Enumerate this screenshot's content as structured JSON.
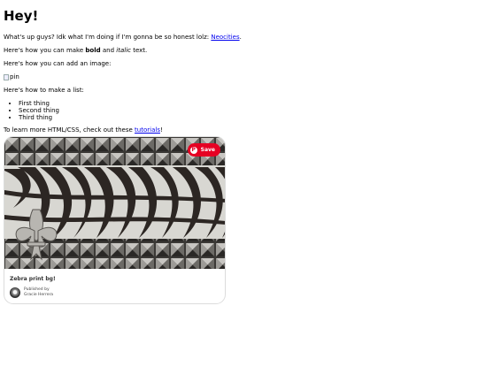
{
  "heading": "Hey!",
  "intro": {
    "text": "What's up guys? Idk what I'm doing if I'm gonna be so honest lolz: ",
    "link": "Neocities",
    "end": "."
  },
  "formatting": {
    "pre": "Here's how you can make ",
    "bold": "bold",
    "mid": " and ",
    "italic": "italic",
    "post": " text."
  },
  "image_intro": "Here's how you can add an image:",
  "image_alt": "pin",
  "list_intro": "Here's how to make a list:",
  "list_items": [
    "First thing",
    "Second thing",
    "Third thing"
  ],
  "learn": {
    "pre": "To learn more HTML/CSS, check out these ",
    "link": "tutorials",
    "post": "!"
  },
  "pin": {
    "save_label": "Save",
    "logo_glyph": "P",
    "title": "Zebra print bg!",
    "published_by_label": "Published by",
    "publisher_name": "Gracie Herrera",
    "accent_color": "#e60023"
  }
}
